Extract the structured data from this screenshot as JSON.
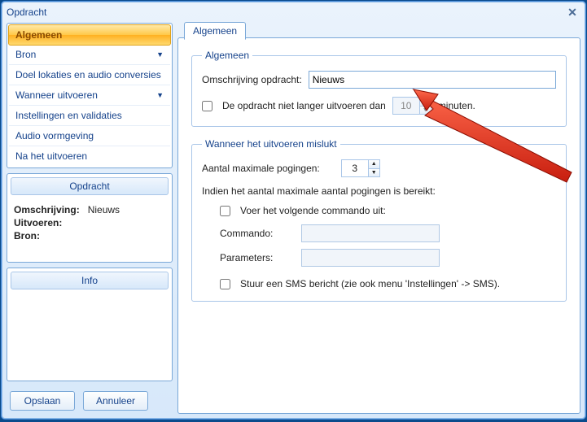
{
  "window": {
    "title": "Opdracht"
  },
  "nav": {
    "items": [
      {
        "label": "Algemeen",
        "selected": true,
        "expandable": false
      },
      {
        "label": "Bron",
        "selected": false,
        "expandable": true
      },
      {
        "label": "Doel lokaties en audio conversies",
        "selected": false,
        "expandable": false
      },
      {
        "label": "Wanneer uitvoeren",
        "selected": false,
        "expandable": true
      },
      {
        "label": "Instellingen en validaties",
        "selected": false,
        "expandable": false
      },
      {
        "label": "Audio vormgeving",
        "selected": false,
        "expandable": false
      },
      {
        "label": "Na het uitvoeren",
        "selected": false,
        "expandable": false
      }
    ]
  },
  "summary": {
    "title": "Opdracht",
    "omschrijving_label": "Omschrijving:",
    "omschrijving_value": "Nieuws",
    "uitvoeren_label": "Uitvoeren:",
    "uitvoeren_value": "",
    "bron_label": "Bron:",
    "bron_value": ""
  },
  "info": {
    "title": "Info"
  },
  "buttons": {
    "save": "Opslaan",
    "cancel": "Annuleer"
  },
  "main": {
    "tab_label": "Algemeen",
    "group_general": {
      "legend": "Algemeen",
      "desc_label": "Omschrijving opdracht:",
      "desc_value": "Nieuws",
      "timeout_check_label": "De opdracht niet langer uitvoeren dan",
      "timeout_value": "10",
      "timeout_unit": "minuten.",
      "timeout_checked": false
    },
    "group_fail": {
      "legend": "Wanneer het uitvoeren mislukt",
      "max_label": "Aantal maximale pogingen:",
      "max_value": "3",
      "reached_label": "Indien het aantal maximale aantal pogingen is bereikt:",
      "cmd_check_label": "Voer het volgende commando uit:",
      "cmd_label": "Commando:",
      "cmd_value": "",
      "param_label": "Parameters:",
      "param_value": "",
      "sms_check_label": "Stuur een SMS bericht (zie ook menu 'Instellingen' -> SMS)."
    }
  }
}
